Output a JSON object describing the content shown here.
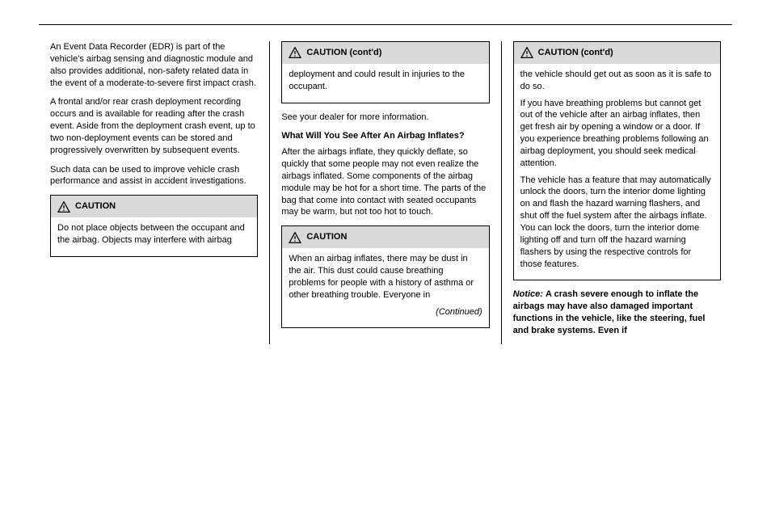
{
  "header": {
    "rule": true
  },
  "col1": {
    "p1": "An Event Data Recorder (EDR) is part of the vehicle's airbag sensing and diagnostic module and also provides additional, non-safety related data in the event of a moderate-to-severe first impact crash.",
    "p2": "A frontal and/or rear crash deployment recording occurs and is available for reading after the crash event. Aside from the deployment crash event, up to two non-deployment events can be stored and progressively overwritten by subsequent events.",
    "p3": "Such data can be used to improve vehicle crash performance and assist in accident investigations.",
    "caution": {
      "label": "CAUTION",
      "text": "Do not place objects between the occupant and the airbag. Objects may interfere with airbag"
    }
  },
  "col2": {
    "caution_cont": {
      "label": "CAUTION (cont'd)",
      "text": "deployment and could result in injuries to the occupant."
    },
    "p1": "See your dealer for more information.",
    "sub1": "What Will You See After An Airbag Inflates?",
    "p2": "After the airbags inflate, they quickly deflate, so quickly that some people may not even realize the airbags inflated. Some components of the airbag module may be hot for a short time. The parts of the bag that come into contact with seated occupants may be warm, but not too hot to touch.",
    "caution2": {
      "label": "CAUTION",
      "p1": "When an airbag inflates, there may be dust in the air. This dust could cause breathing problems for people with a history of asthma or other breathing trouble. Everyone in",
      "cont": "(Continued)"
    }
  },
  "col3": {
    "caution_cont": {
      "label": "CAUTION (cont'd)",
      "p1": "the vehicle should get out as soon as it is safe to do so.",
      "p2": "If you have breathing problems but cannot get out of the vehicle after an airbag inflates, then get fresh air by opening a window or a door. If you experience breathing problems following an airbag deployment, you should seek medical attention.",
      "p3": "The vehicle has a feature that may automatically unlock the doors, turn the interior dome lighting on and flash the hazard warning flashers, and shut off the fuel system after the airbags inflate. You can lock the doors, turn the interior dome lighting off and turn off the hazard warning flashers by using the respective controls for those features."
    },
    "notice": {
      "label": "Notice:",
      "text": "A crash severe enough to inflate the airbags may have also damaged important functions in the vehicle, like the steering, fuel and brake systems. Even if"
    }
  }
}
